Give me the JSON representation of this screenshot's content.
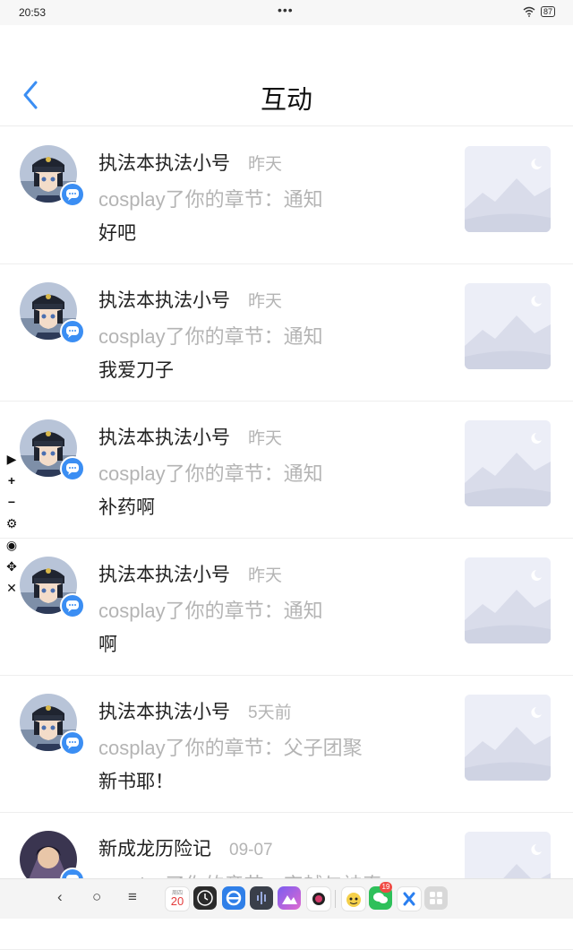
{
  "status_bar": {
    "time": "20:53",
    "dots": "•••",
    "battery": "87"
  },
  "header": {
    "title": "互动"
  },
  "items": [
    {
      "name": "执法本执法小号",
      "time": "昨天",
      "action": "cosplay了你的章节：通知",
      "comment": "好吧"
    },
    {
      "name": "执法本执法小号",
      "time": "昨天",
      "action": "cosplay了你的章节：通知",
      "comment": "我爱刀子"
    },
    {
      "name": "执法本执法小号",
      "time": "昨天",
      "action": "cosplay了你的章节：通知",
      "comment": "补药啊"
    },
    {
      "name": "执法本执法小号",
      "time": "昨天",
      "action": "cosplay了你的章节：通知",
      "comment": "啊"
    },
    {
      "name": "执法本执法小号",
      "time": "5天前",
      "action": "cosplay了你的章节：父子团聚",
      "comment": "新书耶！"
    },
    {
      "name": "新成龙历险记",
      "time": "09-07",
      "action": "cosplay了你的章节：穿越与神奇",
      "comment": ""
    }
  ],
  "float_tools": [
    {
      "icon": "play-icon",
      "glyph": "▶"
    },
    {
      "icon": "plus-icon",
      "glyph": "+"
    },
    {
      "icon": "minus-icon",
      "glyph": "−"
    },
    {
      "icon": "gear-icon",
      "glyph": "⚙"
    },
    {
      "icon": "eye-icon",
      "glyph": "◉"
    },
    {
      "icon": "move-icon",
      "glyph": "✥"
    },
    {
      "icon": "close-icon",
      "glyph": "✕"
    }
  ],
  "dock": {
    "back": "‹",
    "home": "○",
    "menu": "≡",
    "calendar_weekday": "周四",
    "calendar_day": "20",
    "wechat_badge": "19"
  },
  "colors": {
    "accent": "#3b8ef3",
    "muted": "#b4b4b4",
    "badge": "#f04a44"
  }
}
